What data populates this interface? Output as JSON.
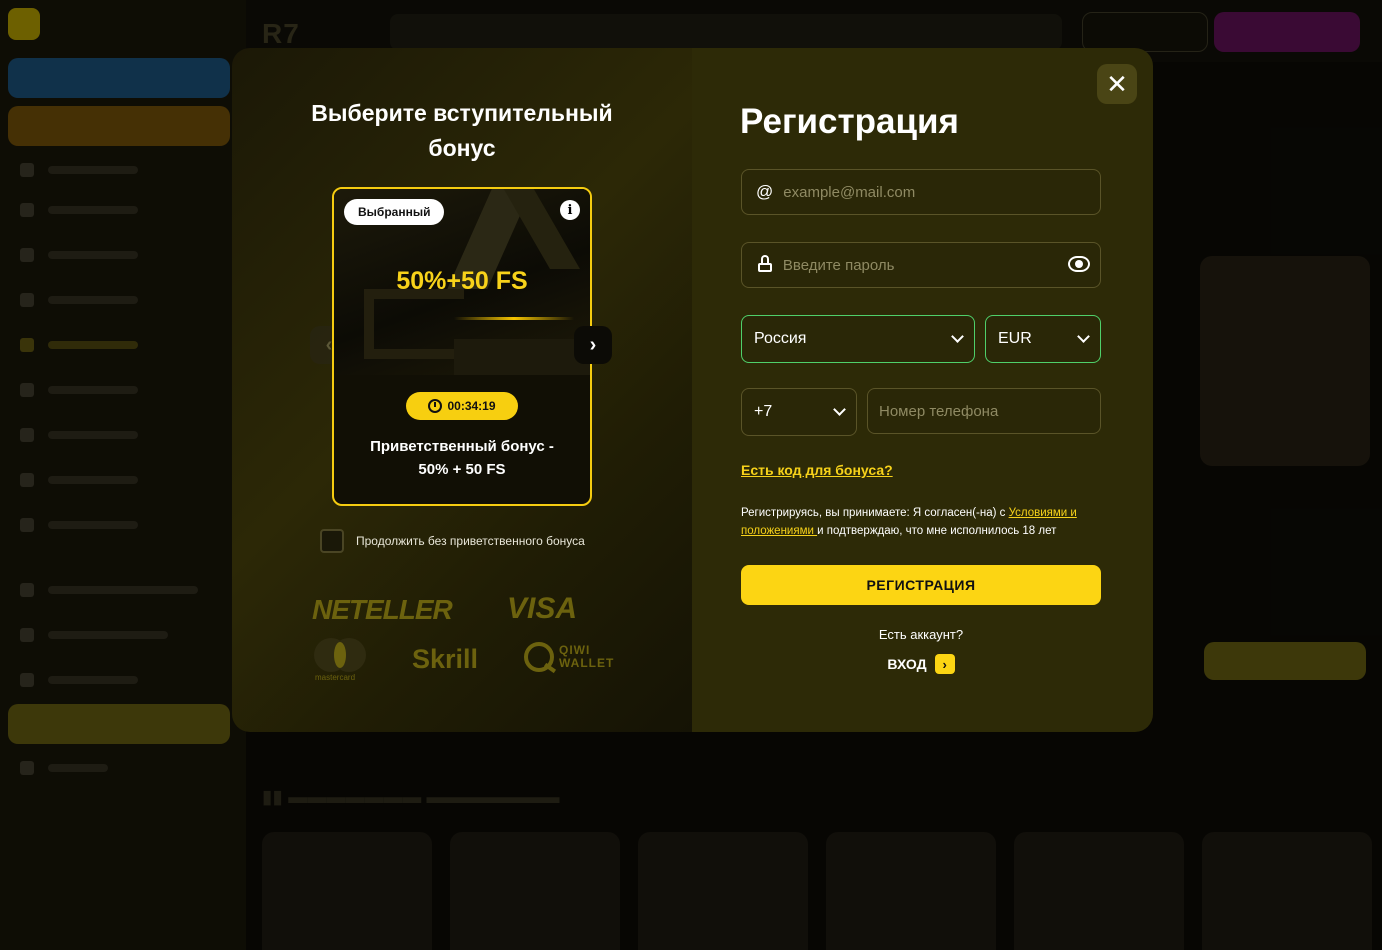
{
  "left_panel": {
    "title_line1": "Выберите вступительный",
    "title_line2": "бонус",
    "card": {
      "chip": "Выбранный",
      "info": "i",
      "amount": "50%+50 FS",
      "timer": "00:34:19",
      "desc_line1": "Приветственный бонус -",
      "desc_line2": "50% + 50 FS"
    },
    "prev_arrow": "‹",
    "next_arrow": "›",
    "skip_label": "Продолжить без приветственного бонуса",
    "payments": {
      "neteller": "NETELLER",
      "visa": "VISA",
      "mastercard": "mastercard",
      "skrill": "Skrill",
      "qiwi_line1": "QIWI",
      "qiwi_line2": "WALLET"
    }
  },
  "right_panel": {
    "close": "✕",
    "title": "Регистрация",
    "email_placeholder": "example@mail.com",
    "email_icon": "@",
    "password_placeholder": "Введите пароль",
    "country": "Россия",
    "currency": "EUR",
    "phone_code": "+7",
    "phone_placeholder": "Номер телефона",
    "promo_link": "Есть код для бонуса?",
    "terms_prefix": "Регистрируясь, вы принимаете: Я согласен(-на) с ",
    "terms_link": "Условиями и положениями ",
    "terms_suffix": "и подтверждаю, что мне исполнилось 18 лет",
    "register_button": "РЕГИСТРАЦИЯ",
    "have_account": "Есть аккаунт?",
    "login_label": "ВХОД",
    "login_arrow": "›"
  },
  "background": {
    "logo": "R7"
  },
  "colors": {
    "accent_yellow": "#fcd513",
    "modal_right_bg": "#2d2a07",
    "select_focus_green": "#4fd06a"
  }
}
